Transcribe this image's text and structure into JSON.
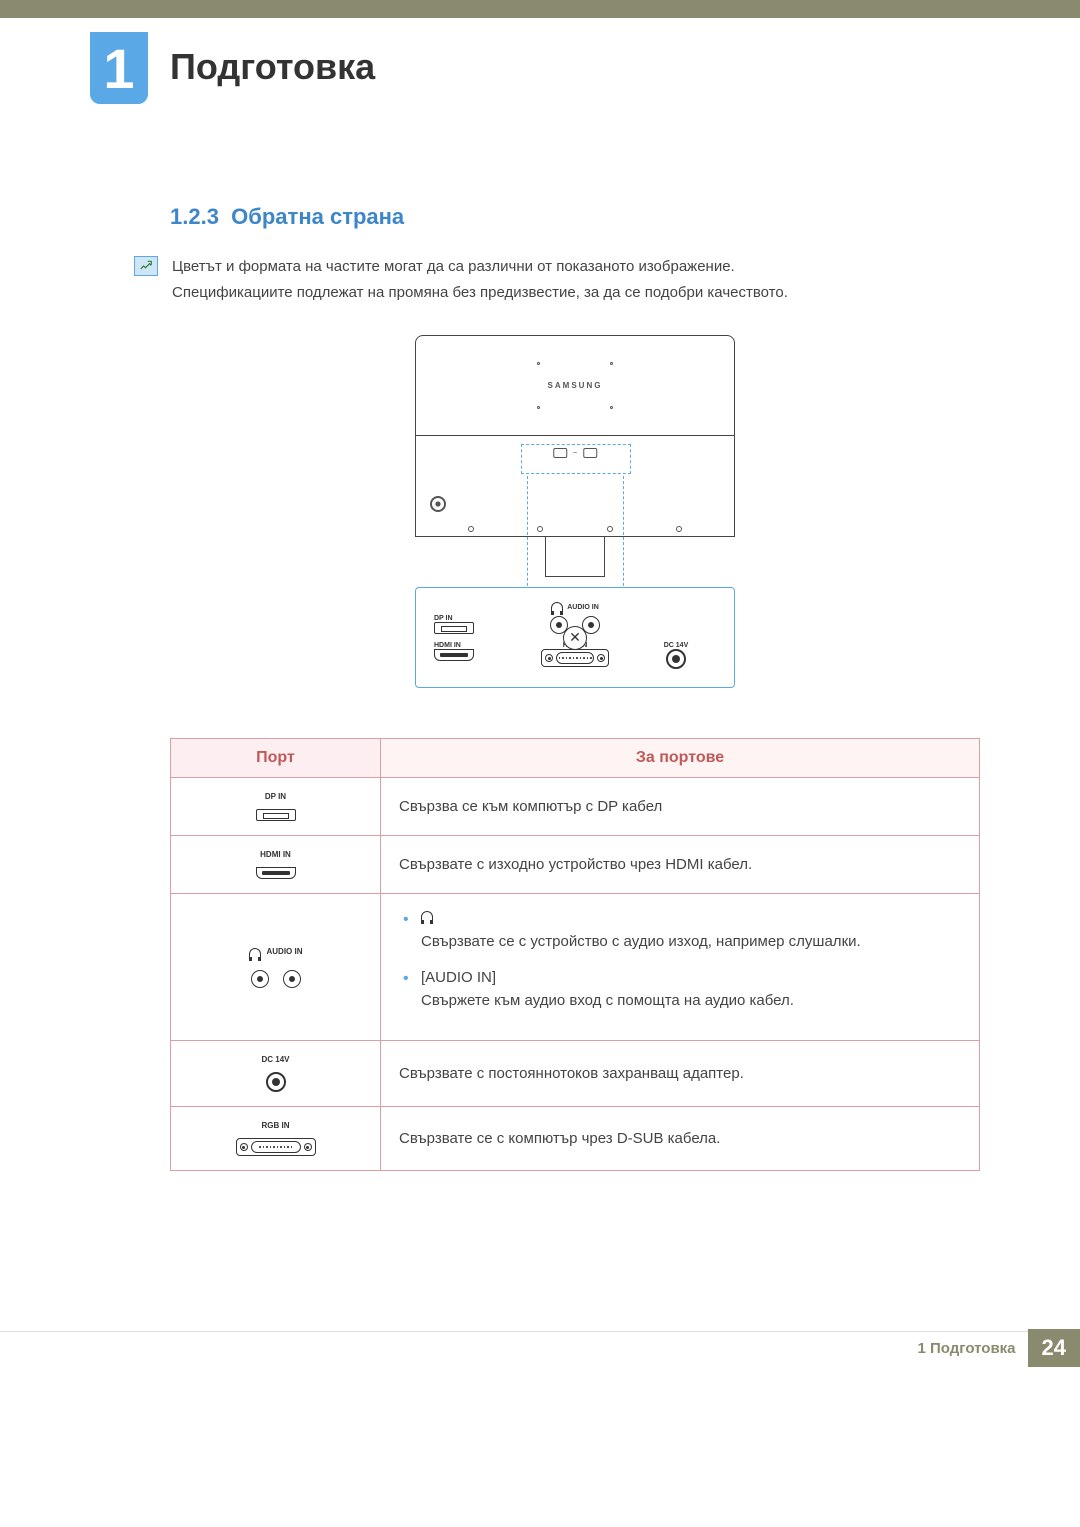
{
  "chapter": {
    "number": "1",
    "title": "Подготовка"
  },
  "section": {
    "number": "1.2.3",
    "title": "Обратна страна"
  },
  "note": {
    "line1": "Цветът и формата на частите могат да са различни от показаното изображение.",
    "line2": "Спецификациите подлежат на промяна без предизвестие, за да се подобри качеството."
  },
  "diagram": {
    "brand": "SAMSUNG",
    "labels": {
      "dp": "DP IN",
      "hdmi": "HDMI IN",
      "audio": "AUDIO IN",
      "rgb": "RGB IN",
      "dc": "DC 14V"
    }
  },
  "table": {
    "headers": {
      "port": "Порт",
      "desc": "За портове"
    },
    "rows": {
      "dp": {
        "label": "DP IN",
        "desc": "Свързва се към компютър с DP кабел"
      },
      "hdmi": {
        "label": "HDMI IN",
        "desc": "Свързвате с изходно устройство чрез HDMI кабел."
      },
      "audio": {
        "label": "AUDIO IN",
        "item1": "Свързвате се с устройство с аудио изход, например слушалки.",
        "item2_label": "[AUDIO IN]",
        "item2": "Свържете към аудио вход с помощта на аудио кабел."
      },
      "dc": {
        "label": "DC 14V",
        "desc": "Свързвате с постояннотоков захранващ адаптер."
      },
      "rgb": {
        "label": "RGB IN",
        "desc": "Свързвате се с компютър чрез D-SUB кабела."
      }
    }
  },
  "footer": {
    "text": "1 Подготовка",
    "page": "24"
  }
}
